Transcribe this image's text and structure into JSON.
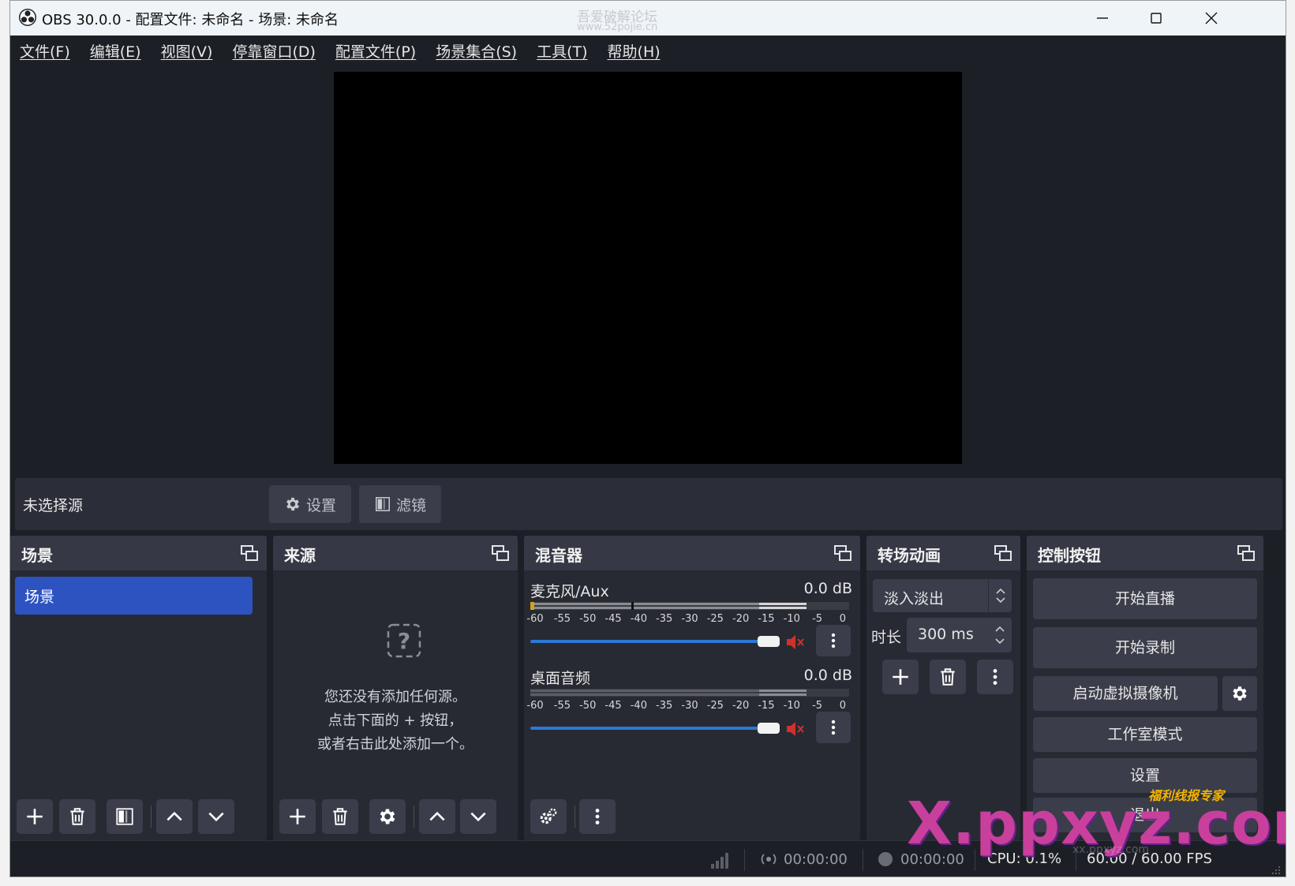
{
  "window": {
    "title": "OBS 30.0.0 - 配置文件: 未命名 - 场景: 未命名",
    "minimize_icon": "minimize-icon",
    "maximize_icon": "maximize-icon",
    "close_icon": "close-icon"
  },
  "watermarks": {
    "top_line1": "吾爱破解论坛",
    "top_line2": "www.52pojie.cn",
    "brand_small": "福利线报专家",
    "brand_large": "X.ppxyz.com",
    "brand_url": "xx.ppxyz.com"
  },
  "menu": [
    "文件(F)",
    "编辑(E)",
    "视图(V)",
    "停靠窗口(D)",
    "配置文件(P)",
    "场景集合(S)",
    "工具(T)",
    "帮助(H)"
  ],
  "source_bar": {
    "no_source": "未选择源",
    "settings_label": "设置",
    "filters_label": "滤镜"
  },
  "scenes": {
    "title": "场景",
    "items": [
      "场景"
    ]
  },
  "sources": {
    "title": "来源",
    "empty_lines": [
      "您还没有添加任何源。",
      "点击下面的 + 按钮，",
      "或者右击此处添加一个。"
    ]
  },
  "mixer": {
    "title": "混音器",
    "ticks": [
      "-60",
      "-55",
      "-50",
      "-45",
      "-40",
      "-35",
      "-30",
      "-25",
      "-20",
      "-15",
      "-10",
      "-5",
      "0"
    ],
    "channels": [
      {
        "name": "麦克风/Aux",
        "db": "0.0 dB",
        "volume": 1.0,
        "muted": true
      },
      {
        "name": "桌面音频",
        "db": "0.0 dB",
        "volume": 1.0,
        "muted": true
      }
    ]
  },
  "transitions": {
    "title": "转场动画",
    "selected": "淡入淡出",
    "duration_label": "时长",
    "duration_value": "300 ms"
  },
  "controls": {
    "title": "控制按钮",
    "start_stream": "开始直播",
    "start_record": "开始录制",
    "virtual_cam": "启动虚拟摄像机",
    "studio_mode": "工作室模式",
    "settings": "设置",
    "exit": "退出"
  },
  "status": {
    "stream_time": "00:00:00",
    "record_time": "00:00:00",
    "cpu": "CPU: 0.1%",
    "fps": "60.00 / 60.00 FPS"
  },
  "colors": {
    "accent_blue": "#2c53c0",
    "slider_blue": "#2c78d4",
    "mute_red": "#d0312d"
  }
}
